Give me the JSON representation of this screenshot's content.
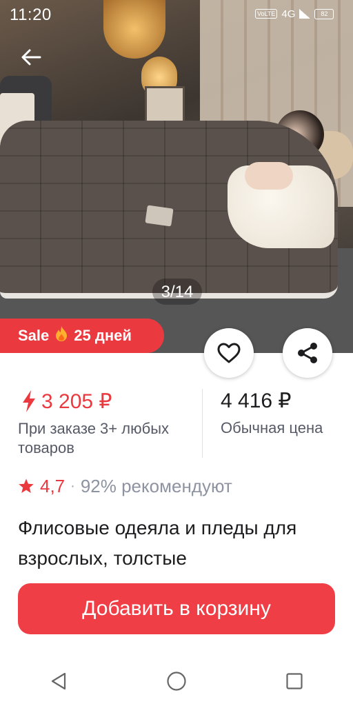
{
  "status_bar": {
    "time": "11:20",
    "volte": "VoLTE",
    "network": "4G",
    "battery": "82"
  },
  "gallery": {
    "counter": "3/14"
  },
  "sale_badge": {
    "label": "Sale",
    "days": "25 дней"
  },
  "price": {
    "sale_value": "3 205 ₽",
    "sale_note": "При заказе 3+ любых товаров",
    "regular_value": "4 416 ₽",
    "regular_note": "Обычная цена"
  },
  "rating": {
    "value": "4,7",
    "separator": "·",
    "recommend": "92% рекомендуют"
  },
  "product": {
    "title": "Флисовые одеяла и пледы для взрослых, толстые"
  },
  "actions": {
    "add_to_cart": "Добавить в корзину"
  },
  "colors": {
    "accent": "#ea3a40",
    "cart_button": "#ef3e45"
  },
  "icons": {
    "back": "arrow-left-icon",
    "favorite": "heart-icon",
    "share": "share-icon",
    "flash": "lightning-icon",
    "star": "star-icon",
    "fire": "fire-icon"
  }
}
